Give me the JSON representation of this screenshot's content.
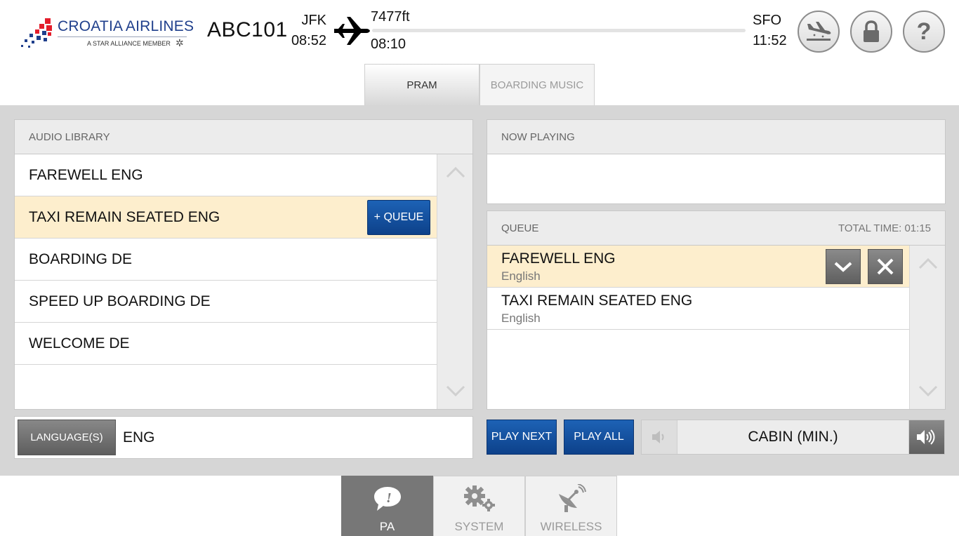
{
  "header": {
    "airline_name": "CROATIA AIRLINES",
    "airline_tagline": "A STAR ALLIANCE MEMBER",
    "flight_number": "ABC101",
    "origin": {
      "code": "JFK",
      "time": "08:52"
    },
    "destination": {
      "code": "SFO",
      "time": "11:52"
    },
    "altitude": "7477ft",
    "elapsed_time": "08:10",
    "buttons": {
      "landing": "landing-plane-icon",
      "lock": "lock-icon",
      "help": "?"
    }
  },
  "tabs": [
    {
      "label": "PRAM",
      "active": true
    },
    {
      "label": "BOARDING MUSIC",
      "active": false
    }
  ],
  "audio_library": {
    "title": "AUDIO LIBRARY",
    "items": [
      {
        "label": "FAREWELL ENG",
        "selected": false
      },
      {
        "label": "TAXI REMAIN SEATED ENG",
        "selected": true
      },
      {
        "label": "BOARDING DE",
        "selected": false
      },
      {
        "label": "SPEED UP BOARDING DE",
        "selected": false
      },
      {
        "label": "WELCOME DE",
        "selected": false
      }
    ],
    "queue_button": "+ QUEUE"
  },
  "now_playing": {
    "title": "NOW PLAYING"
  },
  "queue": {
    "title": "QUEUE",
    "total_time": "TOTAL TIME: 01:15",
    "items": [
      {
        "title": "FAREWELL ENG",
        "language": "English",
        "selected": true
      },
      {
        "title": "TAXI REMAIN SEATED ENG",
        "language": "English",
        "selected": false
      }
    ]
  },
  "language": {
    "button": "LANGUAGE(S)",
    "value": "ENG"
  },
  "controls": {
    "play_next": "PLAY NEXT",
    "play_all": "PLAY ALL",
    "volume_label": "CABIN (MIN.)"
  },
  "bottom_nav": [
    {
      "label": "PA",
      "icon": "speech-bubble-icon",
      "active": true
    },
    {
      "label": "SYSTEM",
      "icon": "gears-icon",
      "active": false
    },
    {
      "label": "WIRELESS",
      "icon": "satellite-dish-icon",
      "active": false
    }
  ],
  "colors": {
    "brand_blue": "#1f3f8c",
    "button_blue": "#0d418a",
    "highlight_row": "#fdeecd",
    "panel_grey": "#d6d6d6"
  }
}
